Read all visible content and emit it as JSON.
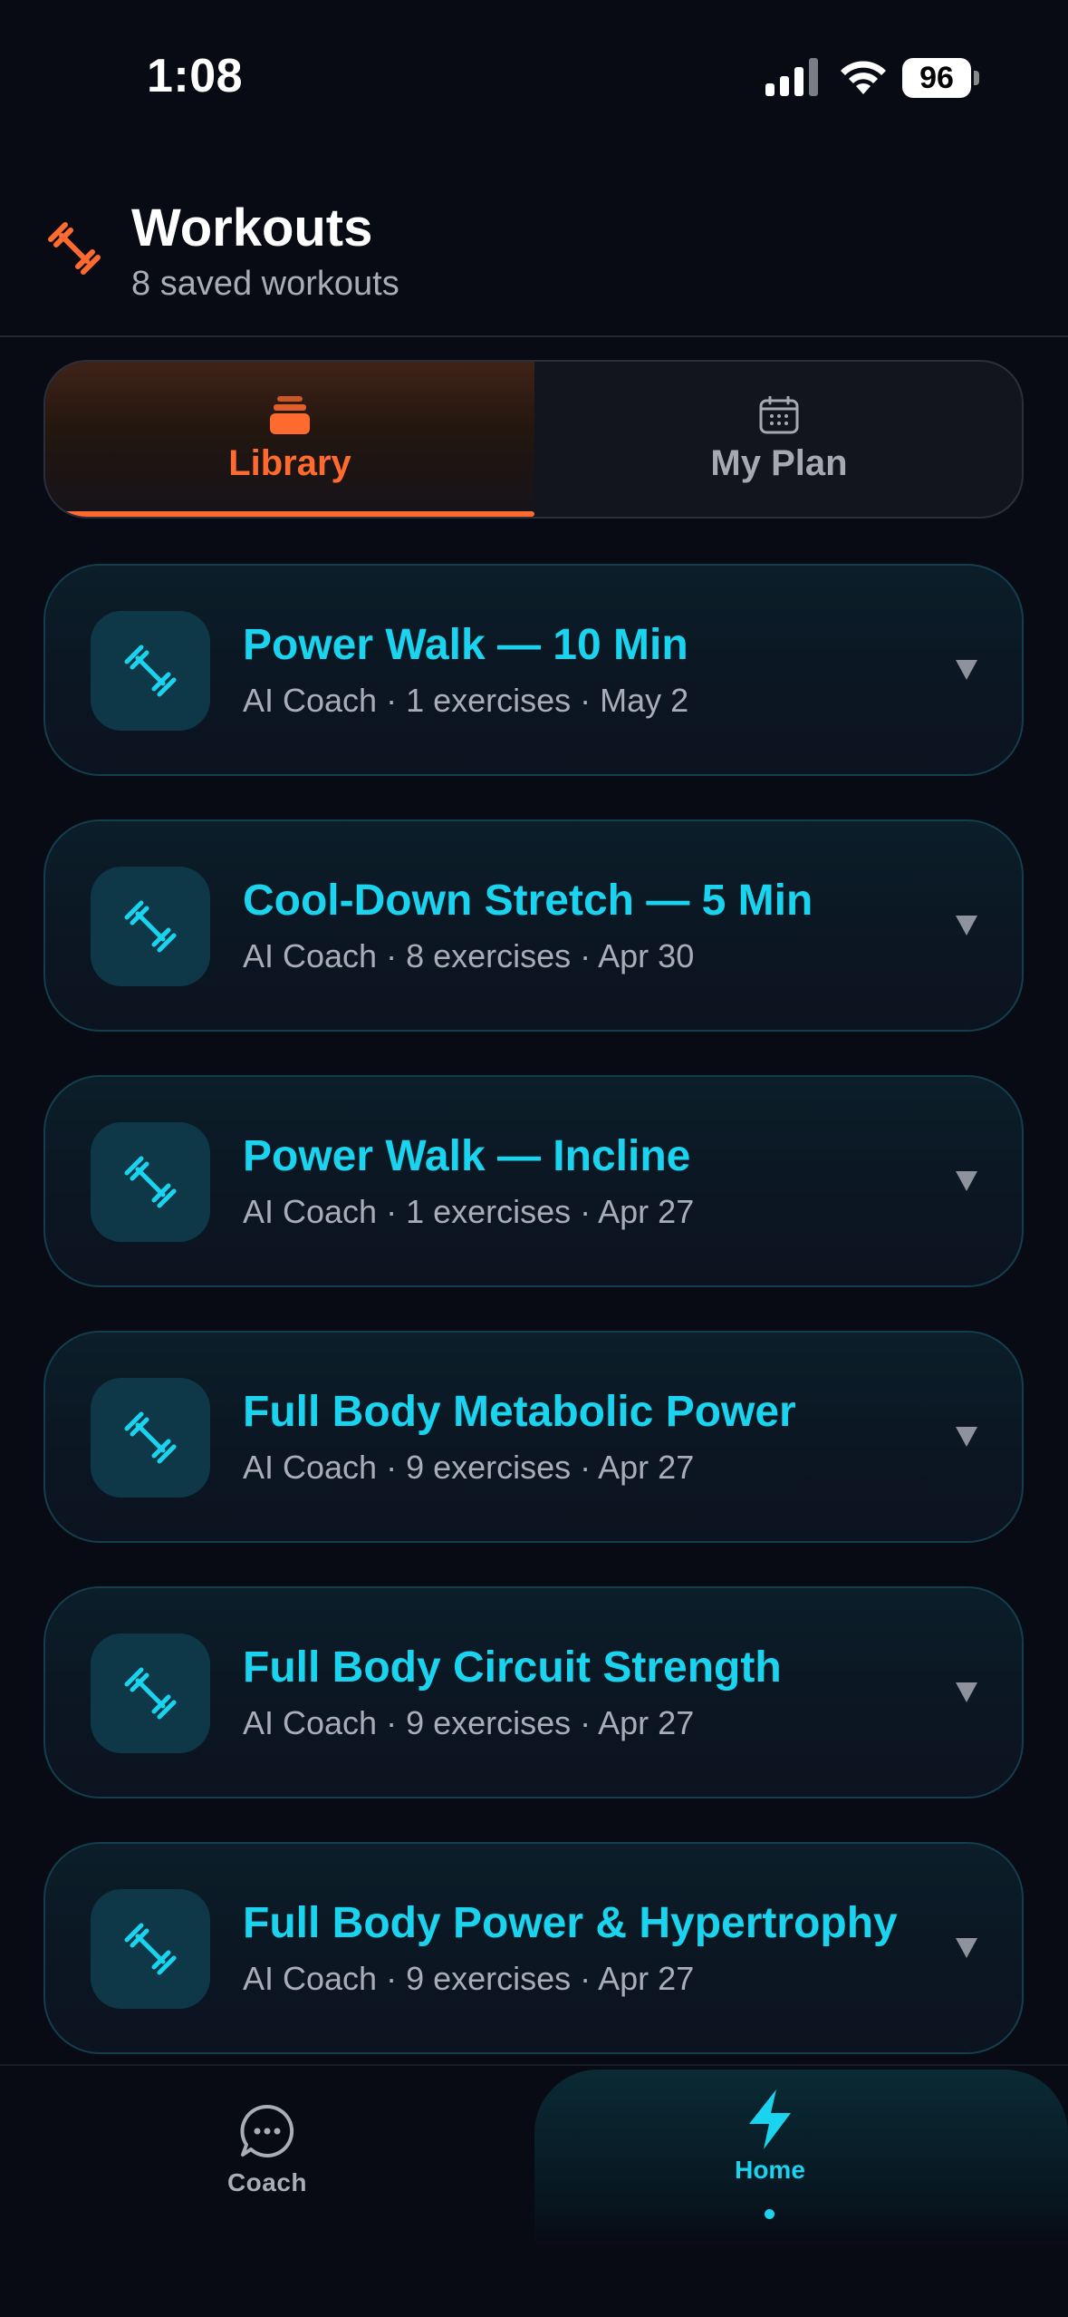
{
  "status_bar": {
    "time": "1:08",
    "battery": "96"
  },
  "header": {
    "title": "Workouts",
    "subtitle": "8 saved workouts",
    "icon": "dumbbell-icon",
    "accent": "#ff6a2e"
  },
  "tabs": {
    "library": {
      "label": "Library",
      "icon": "stack-icon",
      "selected": true
    },
    "my_plan": {
      "label": "My Plan",
      "icon": "calendar-icon",
      "selected": false
    }
  },
  "workouts": [
    {
      "title": "Power Walk — 10 Min",
      "meta": "AI Coach · 1 exercises · May 2"
    },
    {
      "title": "Cool-Down Stretch — 5 Min",
      "meta": "AI Coach · 8 exercises · Apr 30"
    },
    {
      "title": "Power Walk — Incline",
      "meta": "AI Coach · 1 exercises · Apr 27"
    },
    {
      "title": "Full Body Metabolic Power",
      "meta": "AI Coach · 9 exercises · Apr 27"
    },
    {
      "title": "Full Body Circuit Strength",
      "meta": "AI Coach · 9 exercises · Apr 27"
    },
    {
      "title": "Full Body Power & Hypertrophy",
      "meta": "AI Coach · 9 exercises · Apr 27"
    }
  ],
  "tab_bar": {
    "coach": {
      "label": "Coach",
      "icon": "chat-bubble-icon"
    },
    "home": {
      "label": "Home",
      "icon": "lightning-icon",
      "active": true
    }
  },
  "colors": {
    "background": "#080a14",
    "primary": "#1ad3ee",
    "accent": "#ff6a2e",
    "muted_text": "#a9adb8"
  }
}
